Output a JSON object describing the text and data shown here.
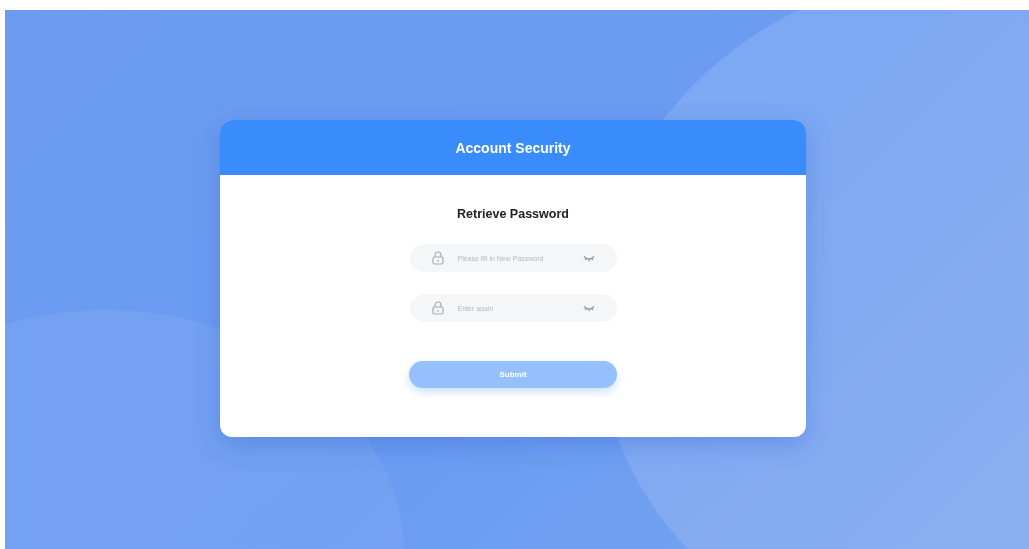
{
  "dialog": {
    "title": "Account Security",
    "heading": "Retrieve Password",
    "fields": [
      {
        "placeholder": "Please fill in New Password"
      },
      {
        "placeholder": "Enter again"
      }
    ],
    "submit": {
      "label": "Submit",
      "disabled": true
    }
  }
}
